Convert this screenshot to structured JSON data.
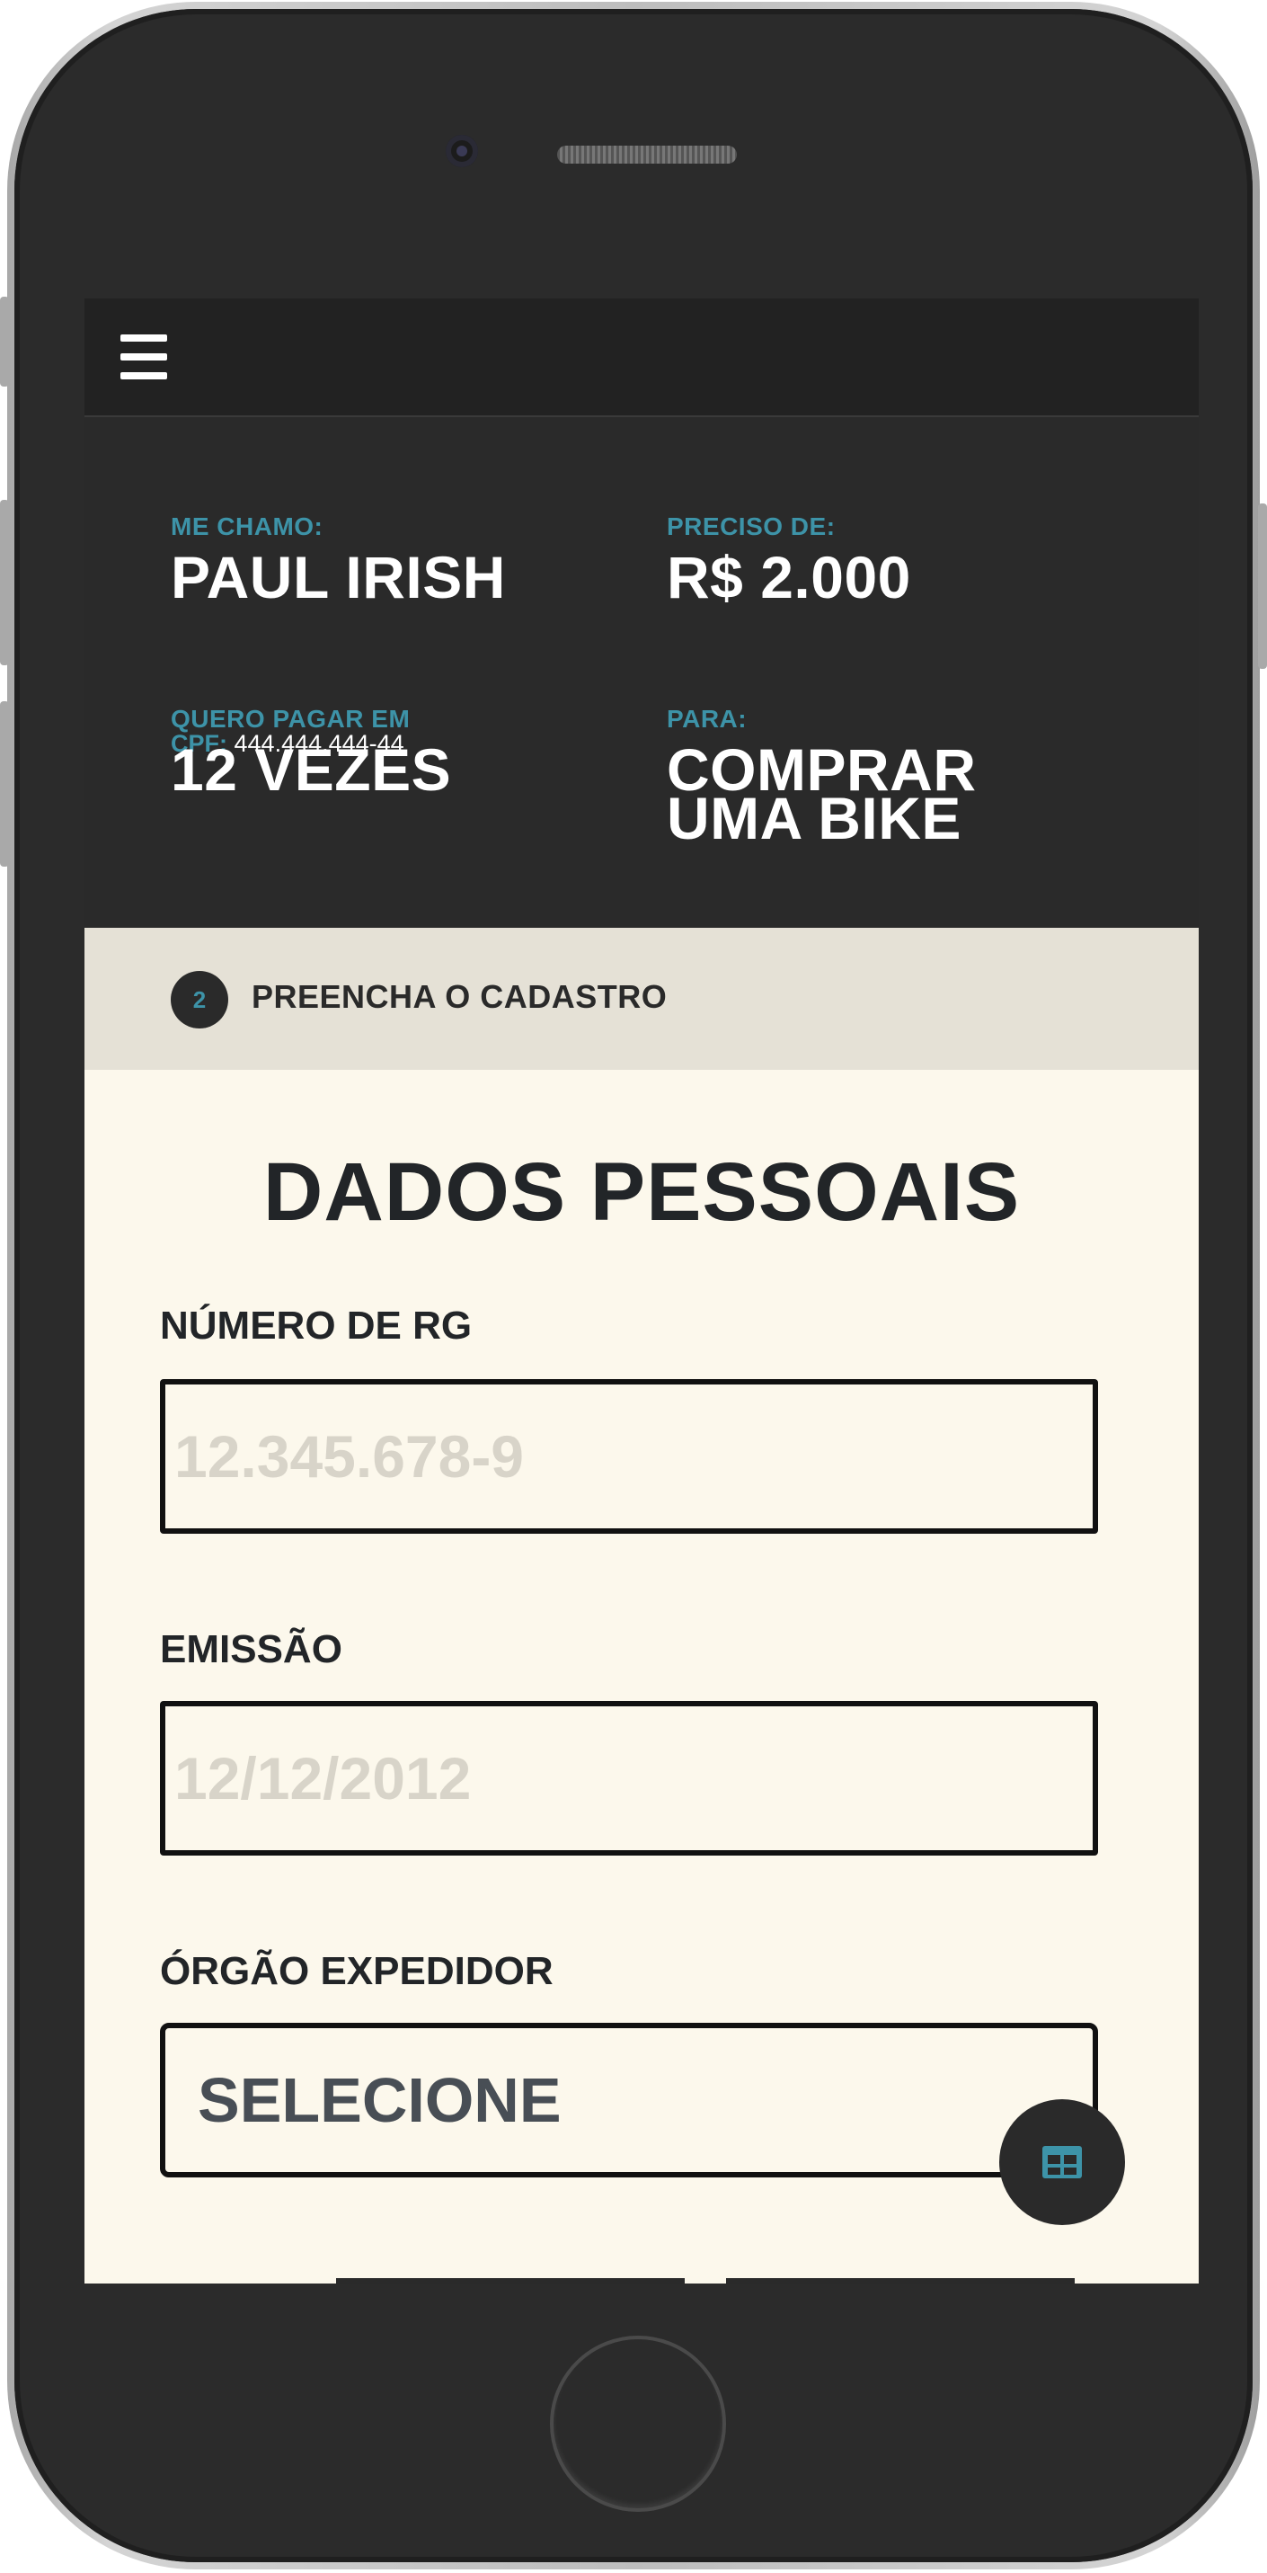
{
  "summary": {
    "name_label": "ME CHAMO:",
    "name_value": "PAUL IRISH",
    "cpf_label": "CPF:",
    "cpf_value": "444.444.444-44",
    "amount_label": "PRECISO DE:",
    "amount_value": "R$ 2.000",
    "installments_label": "QUERO PAGAR EM",
    "installments_value": "12 VEZES",
    "purpose_label": "PARA:",
    "purpose_value_line1": "COMPRAR",
    "purpose_value_line2": "UMA BIKE"
  },
  "step": {
    "number": "2",
    "label": "PREENCHA O CADASTRO"
  },
  "form": {
    "title": "DADOS PESSOAIS",
    "rg_label": "NÚMERO DE RG",
    "rg_placeholder": "12.345.678-9",
    "emission_label": "EMISSÃO",
    "emission_placeholder": "12/12/2012",
    "issuer_label": "ÓRGÃO EXPEDIDOR",
    "issuer_selected": "SELECIONE"
  },
  "icons": {
    "menu": "hamburger-menu-icon",
    "fab": "table-icon"
  },
  "colors": {
    "accent": "#3d93a8",
    "dark": "#2a2a2a",
    "cream": "#fcf8ec",
    "step_bar": "#e5e1d6"
  }
}
